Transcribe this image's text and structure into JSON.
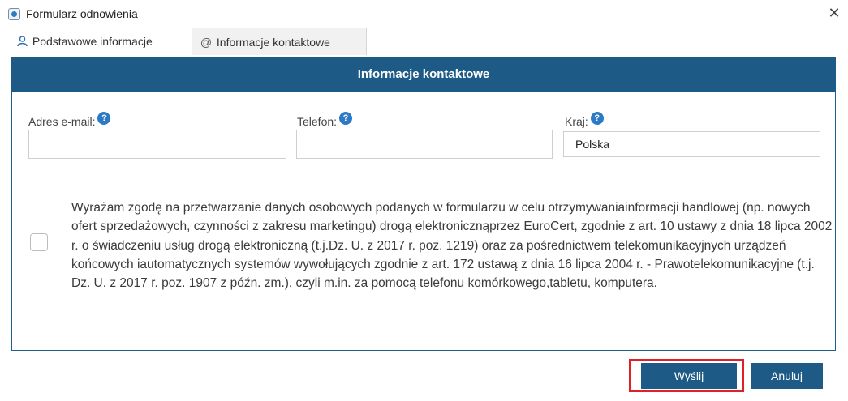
{
  "window": {
    "title": "Formularz odnowienia",
    "close_label": "✕",
    "icon": "app-icon"
  },
  "tabs": [
    {
      "label": "Podstawowe informacje",
      "icon": "user-icon",
      "glyph": "ዶ",
      "active": false
    },
    {
      "label": "Informacje kontaktowe",
      "icon": "at-icon",
      "glyph": "@",
      "active": true
    }
  ],
  "panel": {
    "header": "Informacje kontaktowe"
  },
  "fields": {
    "email": {
      "label": "Adres e-mail:",
      "value": ""
    },
    "phone": {
      "label": "Telefon:",
      "value": ""
    },
    "country": {
      "label": "Kraj:",
      "value": "Polska"
    },
    "help_glyph": "?"
  },
  "consent": {
    "checked": false,
    "text": "Wyrażam zgodę na przetwarzanie danych osobowych podanych w formularzu w celu otrzymywaniainformacji handlowej (np. nowych ofert sprzedażowych, czynności z zakresu marketingu) drogą elektronicznąprzez EuroCert, zgodnie z art. 10 ustawy z dnia 18 lipca 2002 r. o świadczeniu usług drogą elektroniczną (t.j.Dz. U. z 2017 r. poz. 1219) oraz za pośrednictwem telekomunikacyjnych urządzeń końcowych iautomatycznych systemów wywołujących zgodnie z art. 172 ustawą z dnia 16 lipca 2004 r. - Prawotelekomunikacyjne (t.j. Dz. U. z 2017 r. poz. 1907 z późn. zm.), czyli m.in. za pomocą telefonu komórkowego,tabletu, komputera."
  },
  "buttons": {
    "send": "Wyślij",
    "cancel": "Anuluj"
  },
  "colors": {
    "brand_blue": "#1d5b86",
    "help_blue": "#2c79c5",
    "highlight_red": "#e01f26"
  }
}
